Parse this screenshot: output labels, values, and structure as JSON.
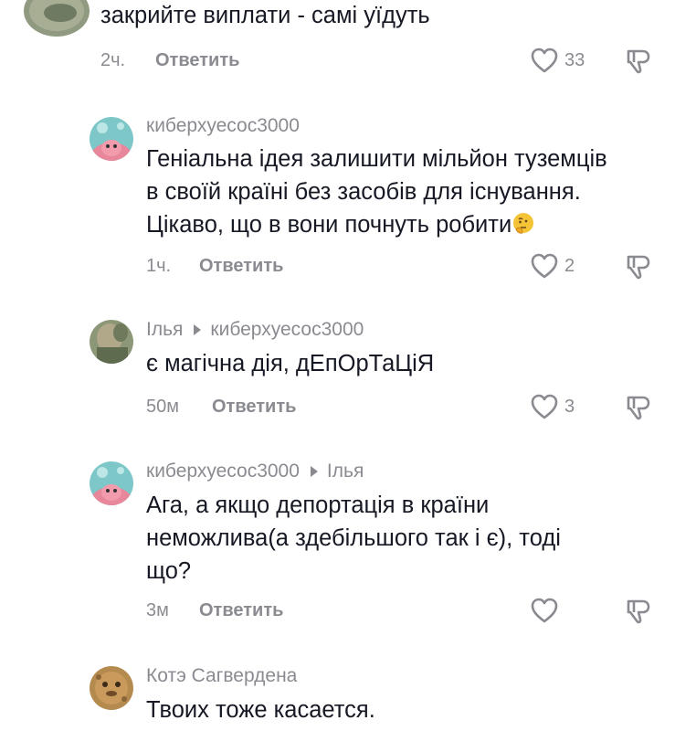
{
  "comments": [
    {
      "text_lines": [
        "закрийте виплати - самі уїдуть"
      ],
      "time": "2ч.",
      "reply_label": "Ответить",
      "likes": "33"
    },
    {
      "username": "киберхуесос3000",
      "text_lines": [
        "Геніальна ідея залишити мільйон туземців",
        "в своїй країні без засобів для існування.",
        "Цікаво, що в вони почнуть робити"
      ],
      "emoji": "thinking-face",
      "time": "1ч.",
      "reply_label": "Ответить",
      "likes": "2"
    },
    {
      "username": "Ілья",
      "reply_to": "киберхуесос3000",
      "text_lines": [
        "є магічна дія, дЕпОрТаЦіЯ"
      ],
      "time": "50м",
      "reply_label": "Ответить",
      "likes": "3"
    },
    {
      "username": "киберхуесос3000",
      "reply_to": "Ілья",
      "text_lines": [
        "Ага, а якщо депортація в країни",
        "неможлива(а здебільшого так і є), тоді",
        "що?"
      ],
      "time": "3м",
      "reply_label": "Ответить",
      "likes": ""
    },
    {
      "username": "Котэ Сагвердена",
      "text_lines": [
        "Твоих тоже касается."
      ]
    }
  ],
  "colors": {
    "text": "#161823",
    "secondary": "#8a8b91",
    "background": "#ffffff"
  },
  "icons": {
    "like": "heart-outline-icon",
    "dislike": "thumbs-down-outline-icon",
    "reply_indicator": "caret-right-icon"
  }
}
